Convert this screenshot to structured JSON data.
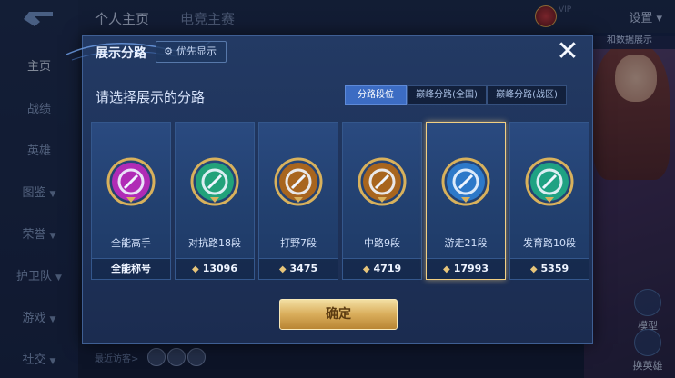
{
  "sidebar": {
    "items": [
      {
        "label": "主页",
        "active": true
      },
      {
        "label": "战绩"
      },
      {
        "label": "英雄"
      },
      {
        "label": "图鉴"
      },
      {
        "label": "荣誉"
      },
      {
        "label": "护卫队"
      },
      {
        "label": "游戏"
      },
      {
        "label": "社交"
      }
    ]
  },
  "topbar": {
    "tabs": [
      "个人主页",
      "电竞主赛"
    ],
    "settings": "设置",
    "vip_label": "VIP"
  },
  "hero": {
    "pill": "和数据展示",
    "buttons": [
      "模型",
      "换英雄"
    ]
  },
  "visitors": {
    "label": "最近访客>"
  },
  "modal": {
    "title": "展示分路",
    "priority_label": "优先显示",
    "subheading": "请选择展示的分路",
    "tabs": [
      {
        "label": "分路段位",
        "active": true
      },
      {
        "label": "巅峰分路(全国)"
      },
      {
        "label": "巅峰分路(战区)"
      }
    ],
    "cards": [
      {
        "name": "全能高手",
        "stat": "全能称号",
        "has_diamond": false,
        "color": "#b02bb6",
        "selected": false
      },
      {
        "name": "对抗路18段",
        "stat": "13096",
        "has_diamond": true,
        "color": "#22a27a",
        "selected": false
      },
      {
        "name": "打野7段",
        "stat": "3475",
        "has_diamond": true,
        "color": "#a8651e",
        "selected": false
      },
      {
        "name": "中路9段",
        "stat": "4719",
        "has_diamond": true,
        "color": "#a8651e",
        "selected": false
      },
      {
        "name": "游走21段",
        "stat": "17993",
        "has_diamond": true,
        "color": "#2d79c9",
        "selected": true
      },
      {
        "name": "发育路10段",
        "stat": "5359",
        "has_diamond": true,
        "color": "#1fa283",
        "selected": false
      }
    ],
    "confirm": "确定"
  }
}
